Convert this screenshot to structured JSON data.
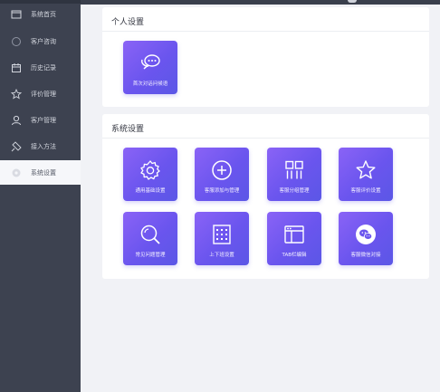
{
  "sidebar": {
    "items": [
      {
        "label": "系统首页",
        "icon": "window-icon"
      },
      {
        "label": "客户咨询",
        "icon": "chat-bubble-icon"
      },
      {
        "label": "历史记录",
        "icon": "calendar-icon"
      },
      {
        "label": "评价管理",
        "icon": "star-icon"
      },
      {
        "label": "客户管理",
        "icon": "user-icon"
      },
      {
        "label": "接入方法",
        "icon": "link-icon"
      },
      {
        "label": "系统设置",
        "icon": "settings-icon"
      }
    ],
    "active_index": 6
  },
  "personal": {
    "title": "个人设置",
    "tiles": [
      {
        "label": "首次对话问候语",
        "icon": "chat-bubbles-icon"
      }
    ]
  },
  "system": {
    "title": "系统设置",
    "tiles": [
      {
        "label": "通用基础设置",
        "icon": "gear-icon"
      },
      {
        "label": "客服添加与管理",
        "icon": "plus-circle-icon"
      },
      {
        "label": "客服分组管理",
        "icon": "grid-columns-icon"
      },
      {
        "label": "客服评价设置",
        "icon": "star-icon"
      },
      {
        "label": "常见问题管理",
        "icon": "magnifier-icon"
      },
      {
        "label": "上下班设置",
        "icon": "calendar-grid-icon"
      },
      {
        "label": "TAB栏编辑",
        "icon": "browser-window-icon"
      },
      {
        "label": "客服微信对接",
        "icon": "wechat-icon"
      }
    ]
  },
  "colors": {
    "sidebar_bg": "#3d4250",
    "tile_gradient_start": "#8a63f6",
    "tile_gradient_end": "#5b57e6"
  }
}
